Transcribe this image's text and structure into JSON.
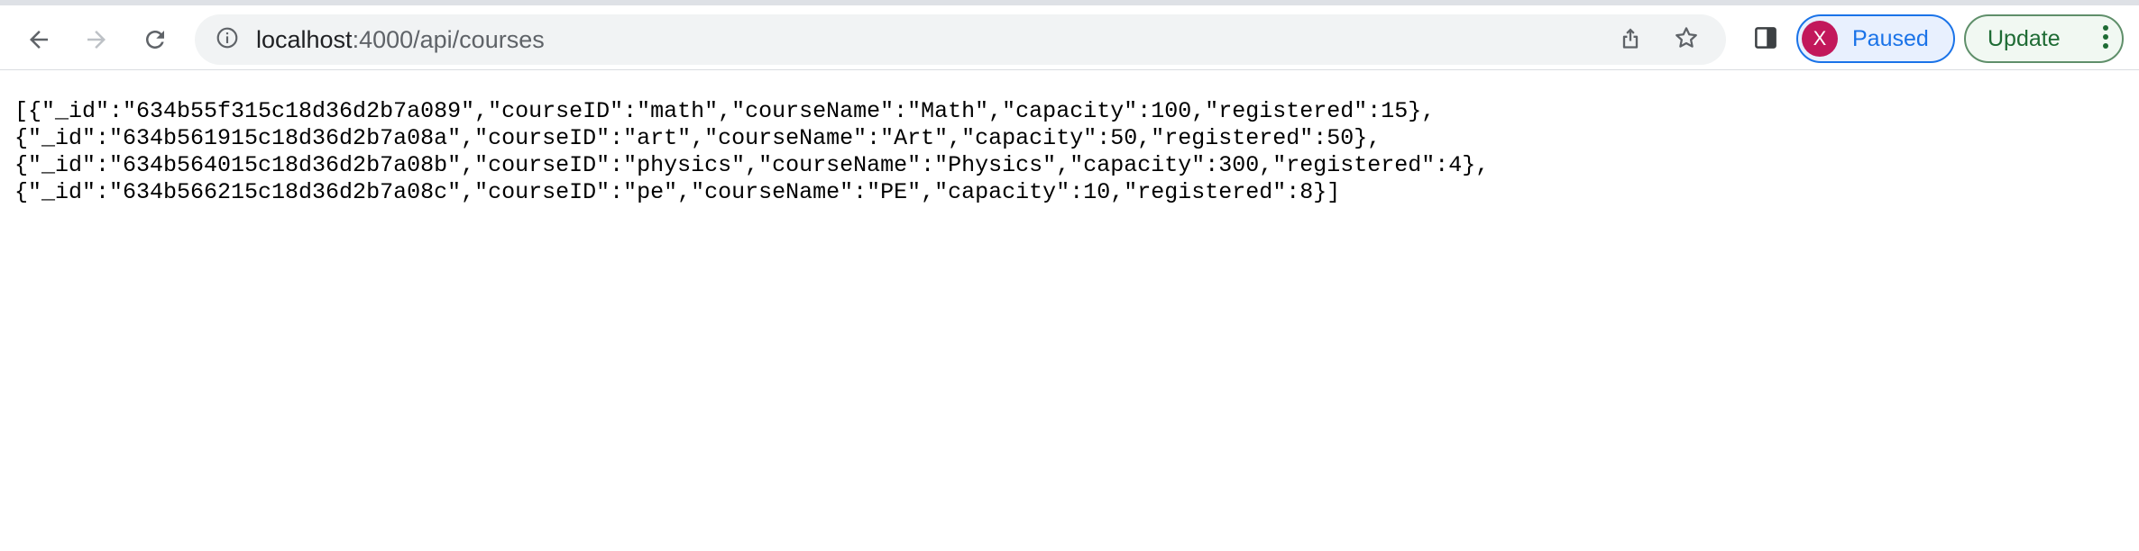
{
  "browser": {
    "url_host": "localhost",
    "url_path": ":4000/api/courses",
    "profile": {
      "initial": "X",
      "label": "Paused"
    },
    "update_label": "Update",
    "icons": {
      "back": "arrow-left-icon",
      "forward": "arrow-right-icon",
      "reload": "reload-icon",
      "site_info": "info-icon",
      "share": "share-icon",
      "bookmark": "star-icon",
      "side_panel": "side-panel-icon",
      "menu": "kebab-menu-icon"
    },
    "colors": {
      "accent": "#1a73e8",
      "avatar": "#c2185b",
      "update": "#1e6b34"
    }
  },
  "content": {
    "lines": [
      "[{\"_id\":\"634b55f315c18d36d2b7a089\",\"courseID\":\"math\",\"courseName\":\"Math\",\"capacity\":100,\"registered\":15},",
      "{\"_id\":\"634b561915c18d36d2b7a08a\",\"courseID\":\"art\",\"courseName\":\"Art\",\"capacity\":50,\"registered\":50},",
      "{\"_id\":\"634b564015c18d36d2b7a08b\",\"courseID\":\"physics\",\"courseName\":\"Physics\",\"capacity\":300,\"registered\":4},",
      "{\"_id\":\"634b566215c18d36d2b7a08c\",\"courseID\":\"pe\",\"courseName\":\"PE\",\"capacity\":10,\"registered\":8}]"
    ]
  }
}
